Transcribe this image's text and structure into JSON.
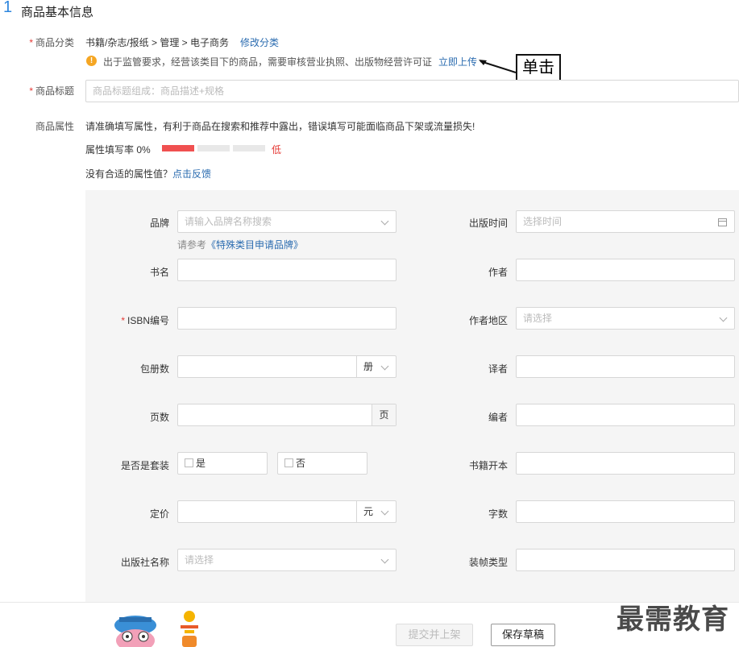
{
  "section": {
    "number": "1",
    "title": "商品基本信息"
  },
  "category": {
    "label": "商品分类",
    "path": "书籍/杂志/报纸 > 管理 > 电子商务",
    "change_link": "修改分类",
    "warning": "出于监管要求，经营该类目下的商品，需要审核营业执照、出版物经营许可证",
    "upload_link": "立即上传",
    "callout": "单击"
  },
  "title_field": {
    "label": "商品标题",
    "placeholder": "商品标题组成：商品描述+规格"
  },
  "attributes": {
    "label": "商品属性",
    "notice": "请准确填写属性，有利于商品在搜索和推荐中露出，错误填写可能面临商品下架或流量损失!",
    "fill_rate_label": "属性填写率 0%",
    "fill_rate": 0.08,
    "fill_level": "低",
    "feedback_prefix": "没有合适的属性值？",
    "feedback_link": "点击反馈"
  },
  "form": {
    "brand": {
      "label": "品牌",
      "placeholder": "请输入品牌名称搜索",
      "hint_prefix": "请参考",
      "hint_link": "《特殊类目申请品牌》"
    },
    "pub_time": {
      "label": "出版时间",
      "placeholder": "选择时间"
    },
    "book_name": {
      "label": "书名"
    },
    "author": {
      "label": "作者"
    },
    "isbn": {
      "label": "ISBN编号"
    },
    "author_region": {
      "label": "作者地区",
      "placeholder": "请选择"
    },
    "volumes": {
      "label": "包册数",
      "unit": "册"
    },
    "translator": {
      "label": "译者"
    },
    "pages": {
      "label": "页数",
      "unit": "页"
    },
    "editor": {
      "label": "编者"
    },
    "is_set": {
      "label": "是否是套装",
      "yes": "是",
      "no": "否"
    },
    "format": {
      "label": "书籍开本"
    },
    "price": {
      "label": "定价",
      "unit": "元"
    },
    "word_count": {
      "label": "字数"
    },
    "publisher": {
      "label": "出版社名称",
      "placeholder": "请选择"
    },
    "binding": {
      "label": "装帧类型"
    }
  },
  "footer": {
    "submit_label": "提交并上架",
    "save_label": "保存草稿",
    "watermark": "最需教育"
  },
  "colors": {
    "accent": "#2e86de",
    "link": "#2b6cb0",
    "danger": "#e53935",
    "warning": "#f5a623"
  }
}
